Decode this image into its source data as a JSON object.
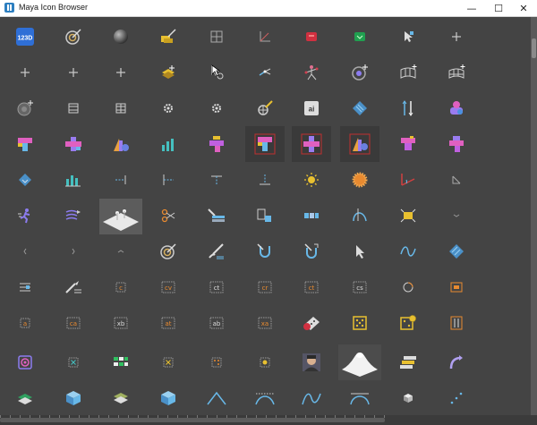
{
  "window": {
    "title": "Maya Icon Browser",
    "minimize_glyph": "—",
    "maximize_glyph": "☐",
    "close_glyph": "✕"
  },
  "colors": {
    "background": "#444444",
    "titlebar": "#ffffff",
    "accent_blue": "#2f6fd6",
    "icon_purple": "#8c7cf0",
    "icon_pink": "#e070d0",
    "icon_teal": "#45c0c0",
    "icon_cyan": "#68b8e8",
    "icon_yellow": "#e8c030",
    "icon_orange": "#e88a30",
    "icon_red": "#e04040",
    "icon_green": "#30c060"
  },
  "icons": [
    [
      "badge-123d",
      "target",
      "sphere",
      "paint-tool",
      "grid-plus",
      "axes-small",
      "red-chip",
      "green-chip",
      "cursor-pin",
      "plus"
    ],
    [
      "plus",
      "plus",
      "plus",
      "layers-add",
      "cursor-gear",
      "arrows-split",
      "joint-skeleton",
      "target-plus",
      "curve-grid-add",
      "curve-grid-add-2"
    ],
    [
      "target-gray",
      "film-strip",
      "film-strip-2",
      "gear",
      "gear-2",
      "magnify-pen",
      "text-ai",
      "diamond-blue",
      "split-arrows",
      "stack-cyl"
    ],
    [
      "gradient-bar-a",
      "gradient-bar-b",
      "gradient-bar-c",
      "bars-teal",
      "gradient-bar-d",
      "gradient-bar-e-sel",
      "gradient-bar-f-sel",
      "gradient-bar-g-sel",
      "gradient-bar-h",
      "gradient-bar-i"
    ],
    [
      "diamond-small",
      "bars-teal-2",
      "dashed-arrow",
      "dashed-branch",
      "dashed-branch-2",
      "dashed-drop",
      "sun",
      "sunburst",
      "angle-red",
      "angle-small"
    ],
    [
      "runner",
      "hair-arrows",
      "pin-plane-preview",
      "scissors-joint",
      "paint-stack",
      "brackets-box",
      "dotted-arrows",
      "pointer-curve",
      "bracket-yellow",
      "chevron-down"
    ],
    [
      "chevron-left",
      "chevron-right",
      "chevron-up",
      "target-2",
      "brush-stroke",
      "magnet",
      "magnet-2",
      "arrow-cursor",
      "wave",
      "stripes-blue"
    ],
    [
      "list-lines",
      "scalpel",
      "node-c",
      "node-cv",
      "node-ct",
      "node-cr",
      "node-ct-2",
      "node-cs",
      "node-circ",
      "node-box"
    ],
    [
      "node-a",
      "node-ca",
      "node-xb",
      "node-at",
      "node-ab",
      "node-xa",
      "node-x",
      "dice-bomb",
      "dice-yellow",
      "dice-gear"
    ],
    [
      "target-purple",
      "box-star",
      "box-grid",
      "box-x",
      "box-dots",
      "box-stamp",
      "portrait",
      "drape-preview",
      "chips-stack",
      "curved-arrow"
    ],
    [
      "layers-green",
      "cube-blue",
      "layers-book",
      "cube-blue-2",
      "curve-peak",
      "curve-bump",
      "curve-wave",
      "curve-arc",
      "cube-small",
      "dotted-line"
    ]
  ]
}
